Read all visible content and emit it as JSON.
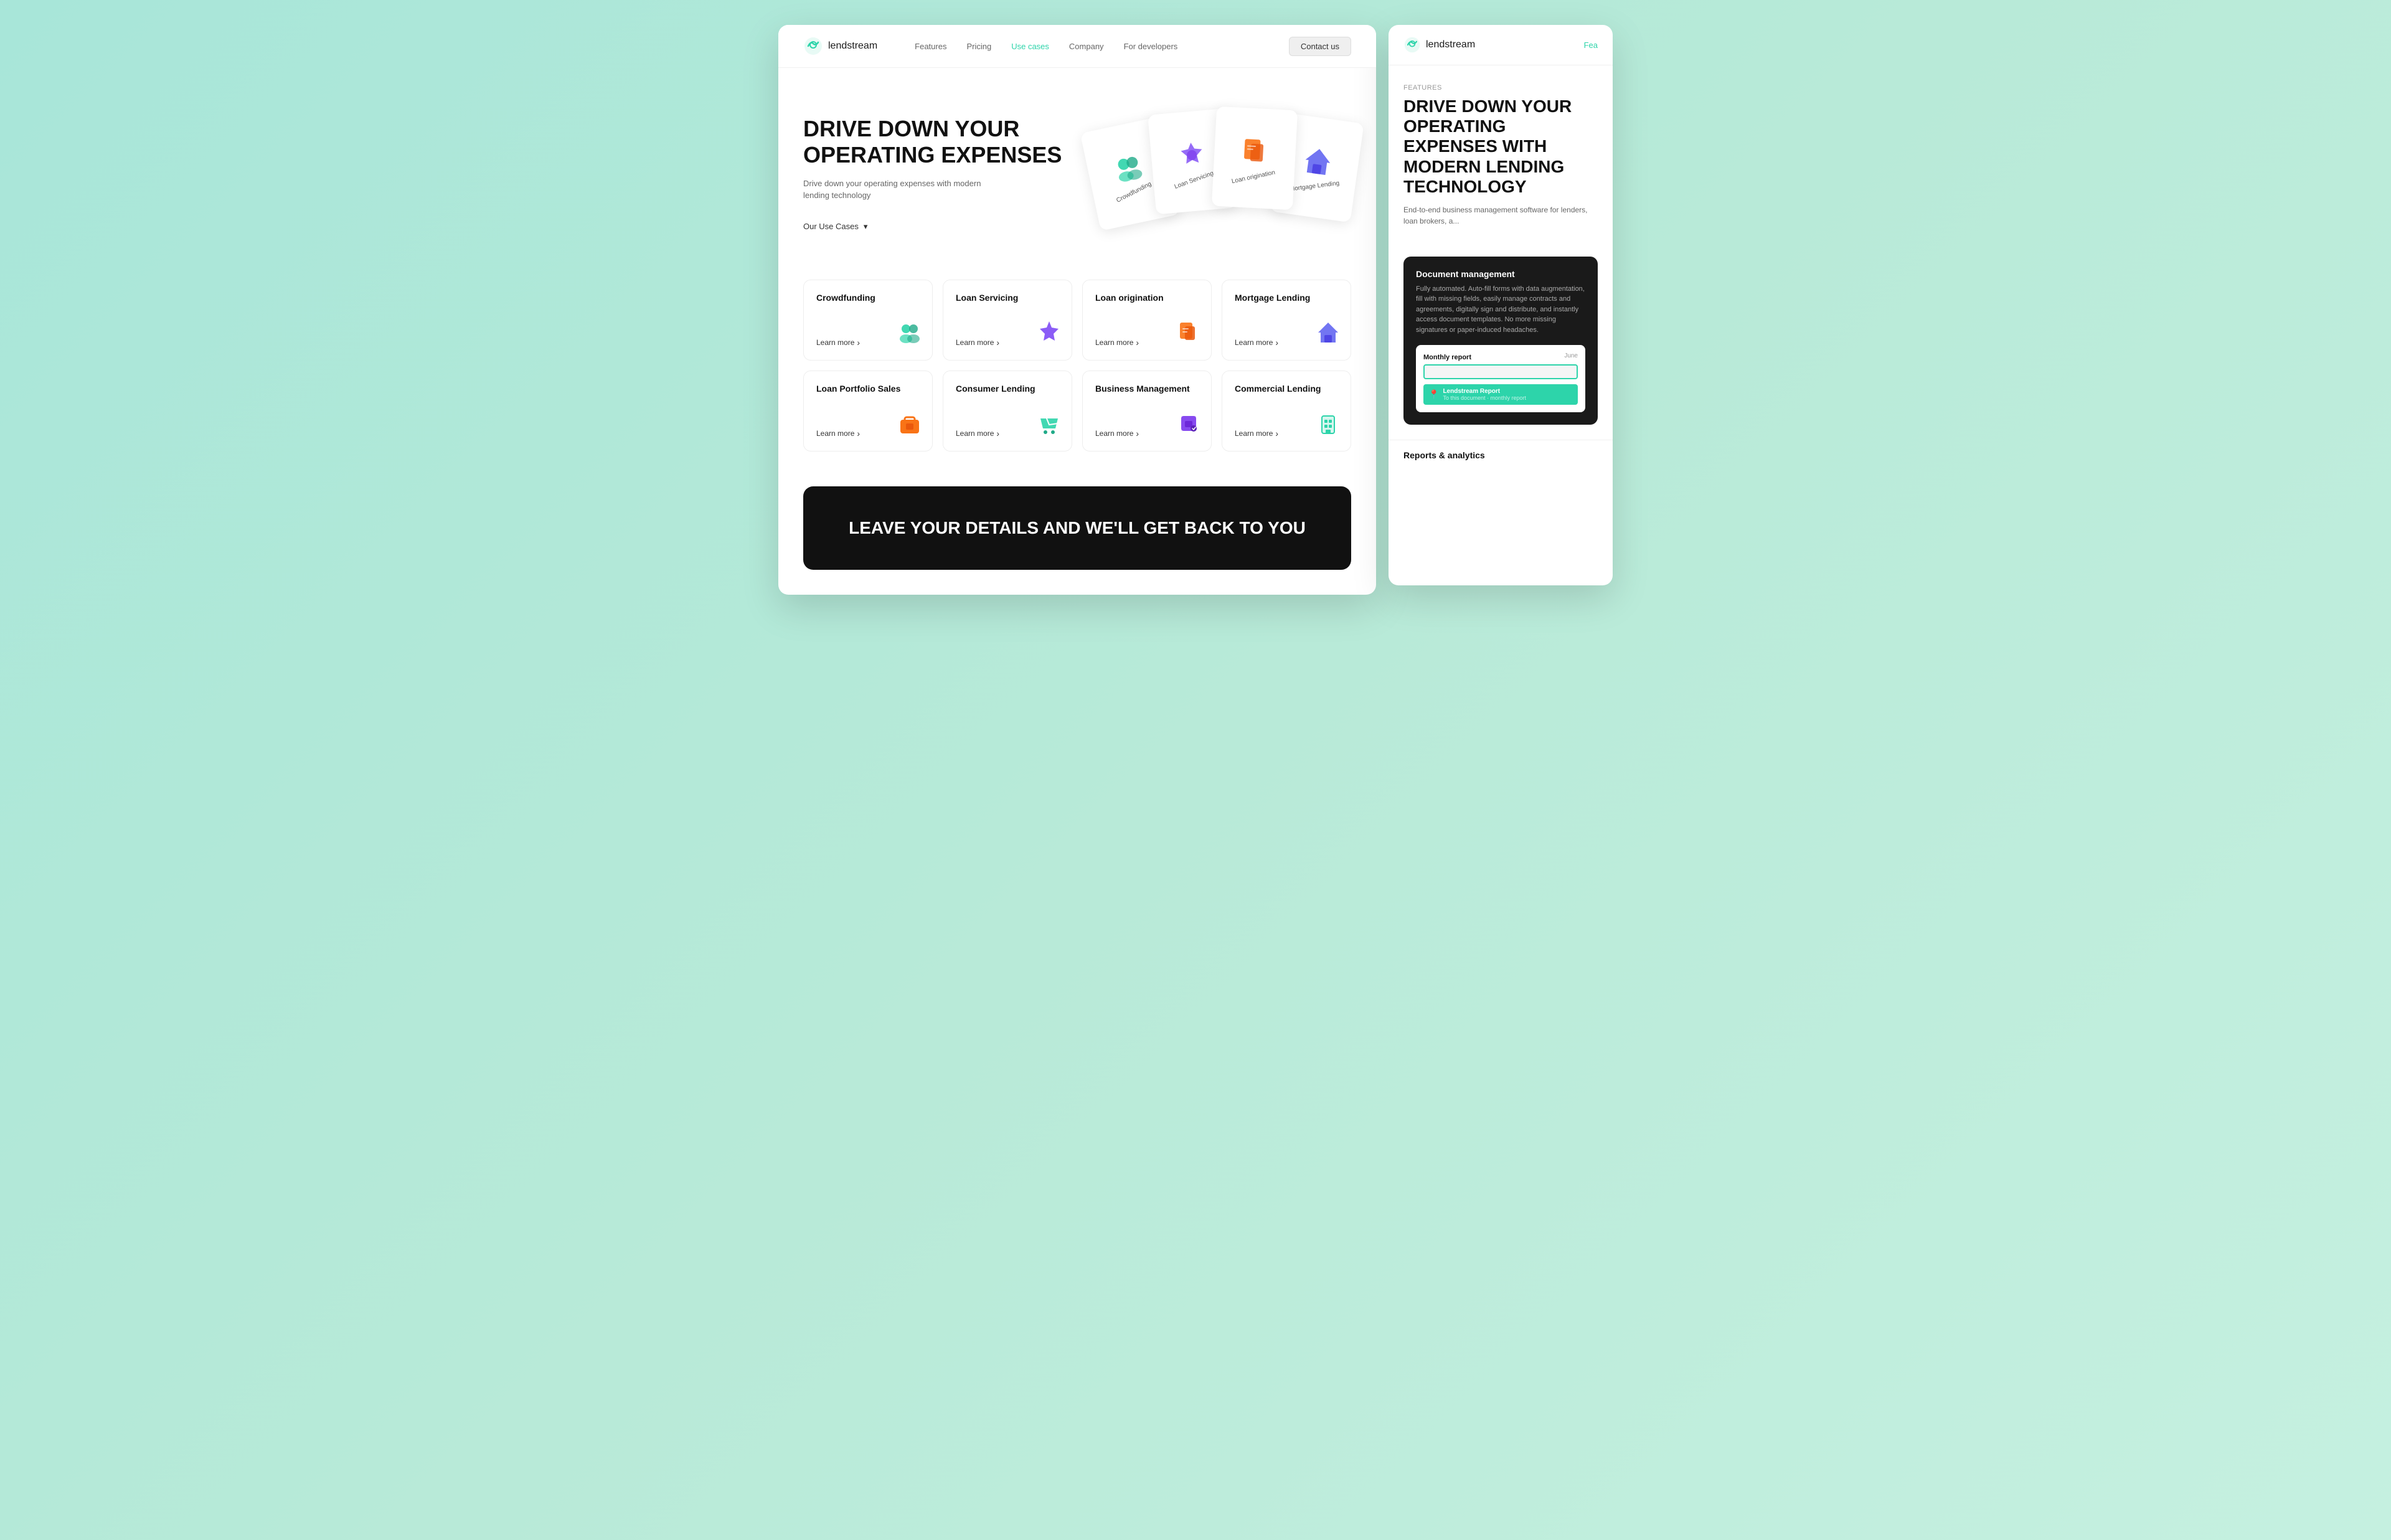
{
  "brand": {
    "name": "lendstream",
    "tagline": "Fea"
  },
  "nav": {
    "links": [
      {
        "label": "Features",
        "active": false
      },
      {
        "label": "Pricing",
        "active": false
      },
      {
        "label": "Use cases",
        "active": true
      },
      {
        "label": "Company",
        "active": false
      },
      {
        "label": "For developers",
        "active": false
      }
    ],
    "contact_label": "Contact us"
  },
  "hero": {
    "title": "DRIVE DOWN YOUR OPERATING EXPENSES",
    "subtitle": "Drive down your operating expenses with modern lending technology",
    "use_cases_label": "Our Use Cases",
    "cards": [
      {
        "label": "Crowdfunding",
        "icon": "👥"
      },
      {
        "label": "Loan Servicing",
        "icon": "⚙️"
      },
      {
        "label": "Loan origination",
        "icon": "📄"
      },
      {
        "label": "Mortgage Lending",
        "icon": "🏠"
      }
    ]
  },
  "use_cases": {
    "rows": [
      [
        {
          "title": "Crowdfunding",
          "icon": "people",
          "color": "#2dd4aa"
        },
        {
          "title": "Loan Servicing",
          "icon": "gear",
          "color": "#8b5cf6"
        },
        {
          "title": "Loan origination",
          "icon": "docs",
          "color": "#f97316"
        },
        {
          "title": "Mortgage Lending",
          "icon": "house",
          "color": "#6366f1"
        }
      ],
      [
        {
          "title": "Loan Portfolio Sales",
          "icon": "briefcase",
          "color": "#ef4444"
        },
        {
          "title": "Consumer Lending",
          "icon": "cart",
          "color": "#2dd4aa"
        },
        {
          "title": "Business Management",
          "icon": "folder",
          "color": "#7c3aed"
        },
        {
          "title": "Commercial Lending",
          "icon": "building",
          "color": "#2dd4aa"
        }
      ]
    ],
    "learn_more_label": "Learn more"
  },
  "cta": {
    "title": "LEAVE YOUR DETAILS AND WE'LL GET BACK TO YOU"
  },
  "second_window": {
    "features_label": "FEATURES",
    "title": "DRIVE DOWN YOUR OPERATING EXPENSES WITH MODERN LENDING TECHNOLOGY",
    "subtitle": "End-to-end business management software for lenders, loan brokers, a...",
    "doc_management": {
      "title": "Document management",
      "description": "Fully automated. Auto-fill forms with data augmentation, fill with missing fields, easily manage contracts and agreements, digitally sign and distribute, and instantly access document templates. No more missing signatures or paper-induced headaches.",
      "monthly_report": "Monthly report",
      "date": "June",
      "file_label": "Lendstream Report",
      "file_sub": "To this document · monthly report"
    },
    "reports_label": "Reports & analytics"
  }
}
